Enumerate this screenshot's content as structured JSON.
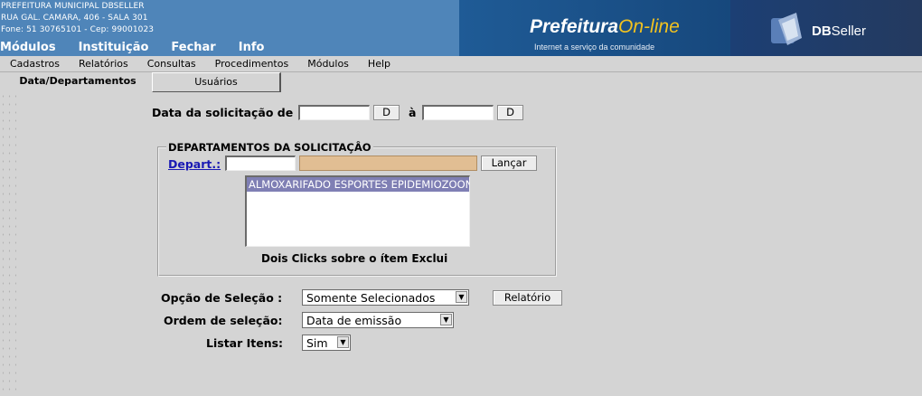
{
  "header": {
    "org_name": "PREFEITURA MUNICIPAL DBSELLER",
    "address": "RUA GAL. CAMARA, 406 - SALA 301",
    "phone": "Fone: 51 30765101  -  Cep: 99001023",
    "top_menu": [
      "Módulos",
      "Instituição",
      "Fechar",
      "Info"
    ],
    "banner_brand": "Prefeitura",
    "banner_online": "On-line",
    "banner_tagline": "Internet a serviço da comunidade",
    "banner_company": "DBSeller",
    "banner_company_bold": "DB",
    "banner_company_rest": "Seller"
  },
  "menubar": [
    "Cadastros",
    "Relatórios",
    "Consultas",
    "Procedimentos",
    "Módulos",
    "Help"
  ],
  "tabs": [
    {
      "label": "Data/Departamentos",
      "active": true
    },
    {
      "label": "Usuários",
      "active": false
    }
  ],
  "date": {
    "label": "Data da solicitação de",
    "from_value": "",
    "d_button": "D",
    "between": "à",
    "to_value": ""
  },
  "departments": {
    "legend": "DEPARTAMENTOS DA SOLICITAÇÂO",
    "link_label": "Depart.:",
    "code_value": "",
    "desc_value": "",
    "launch_button": "Lançar",
    "list_items": [
      "ALMOXARIFADO ESPORTES EPIDEMIOZOONOSES"
    ],
    "hint": "Dois Clicks sobre o ítem Exclui"
  },
  "options": {
    "selection_label": "Opção de Seleção :",
    "selection_value": "Somente Selecionados",
    "report_button": "Relatório",
    "order_label": "Ordem de seleção:",
    "order_value": "Data de emissão",
    "list_label": "Listar Itens:",
    "list_value": "Sim"
  },
  "colors": {
    "header_blue": "#4f85b9",
    "background": "#d4d4d4",
    "selected_item": "#7f7fb4",
    "desc_field": "#e1be93",
    "link": "#1a1ab4",
    "brand_yellow": "#f2c21f"
  }
}
